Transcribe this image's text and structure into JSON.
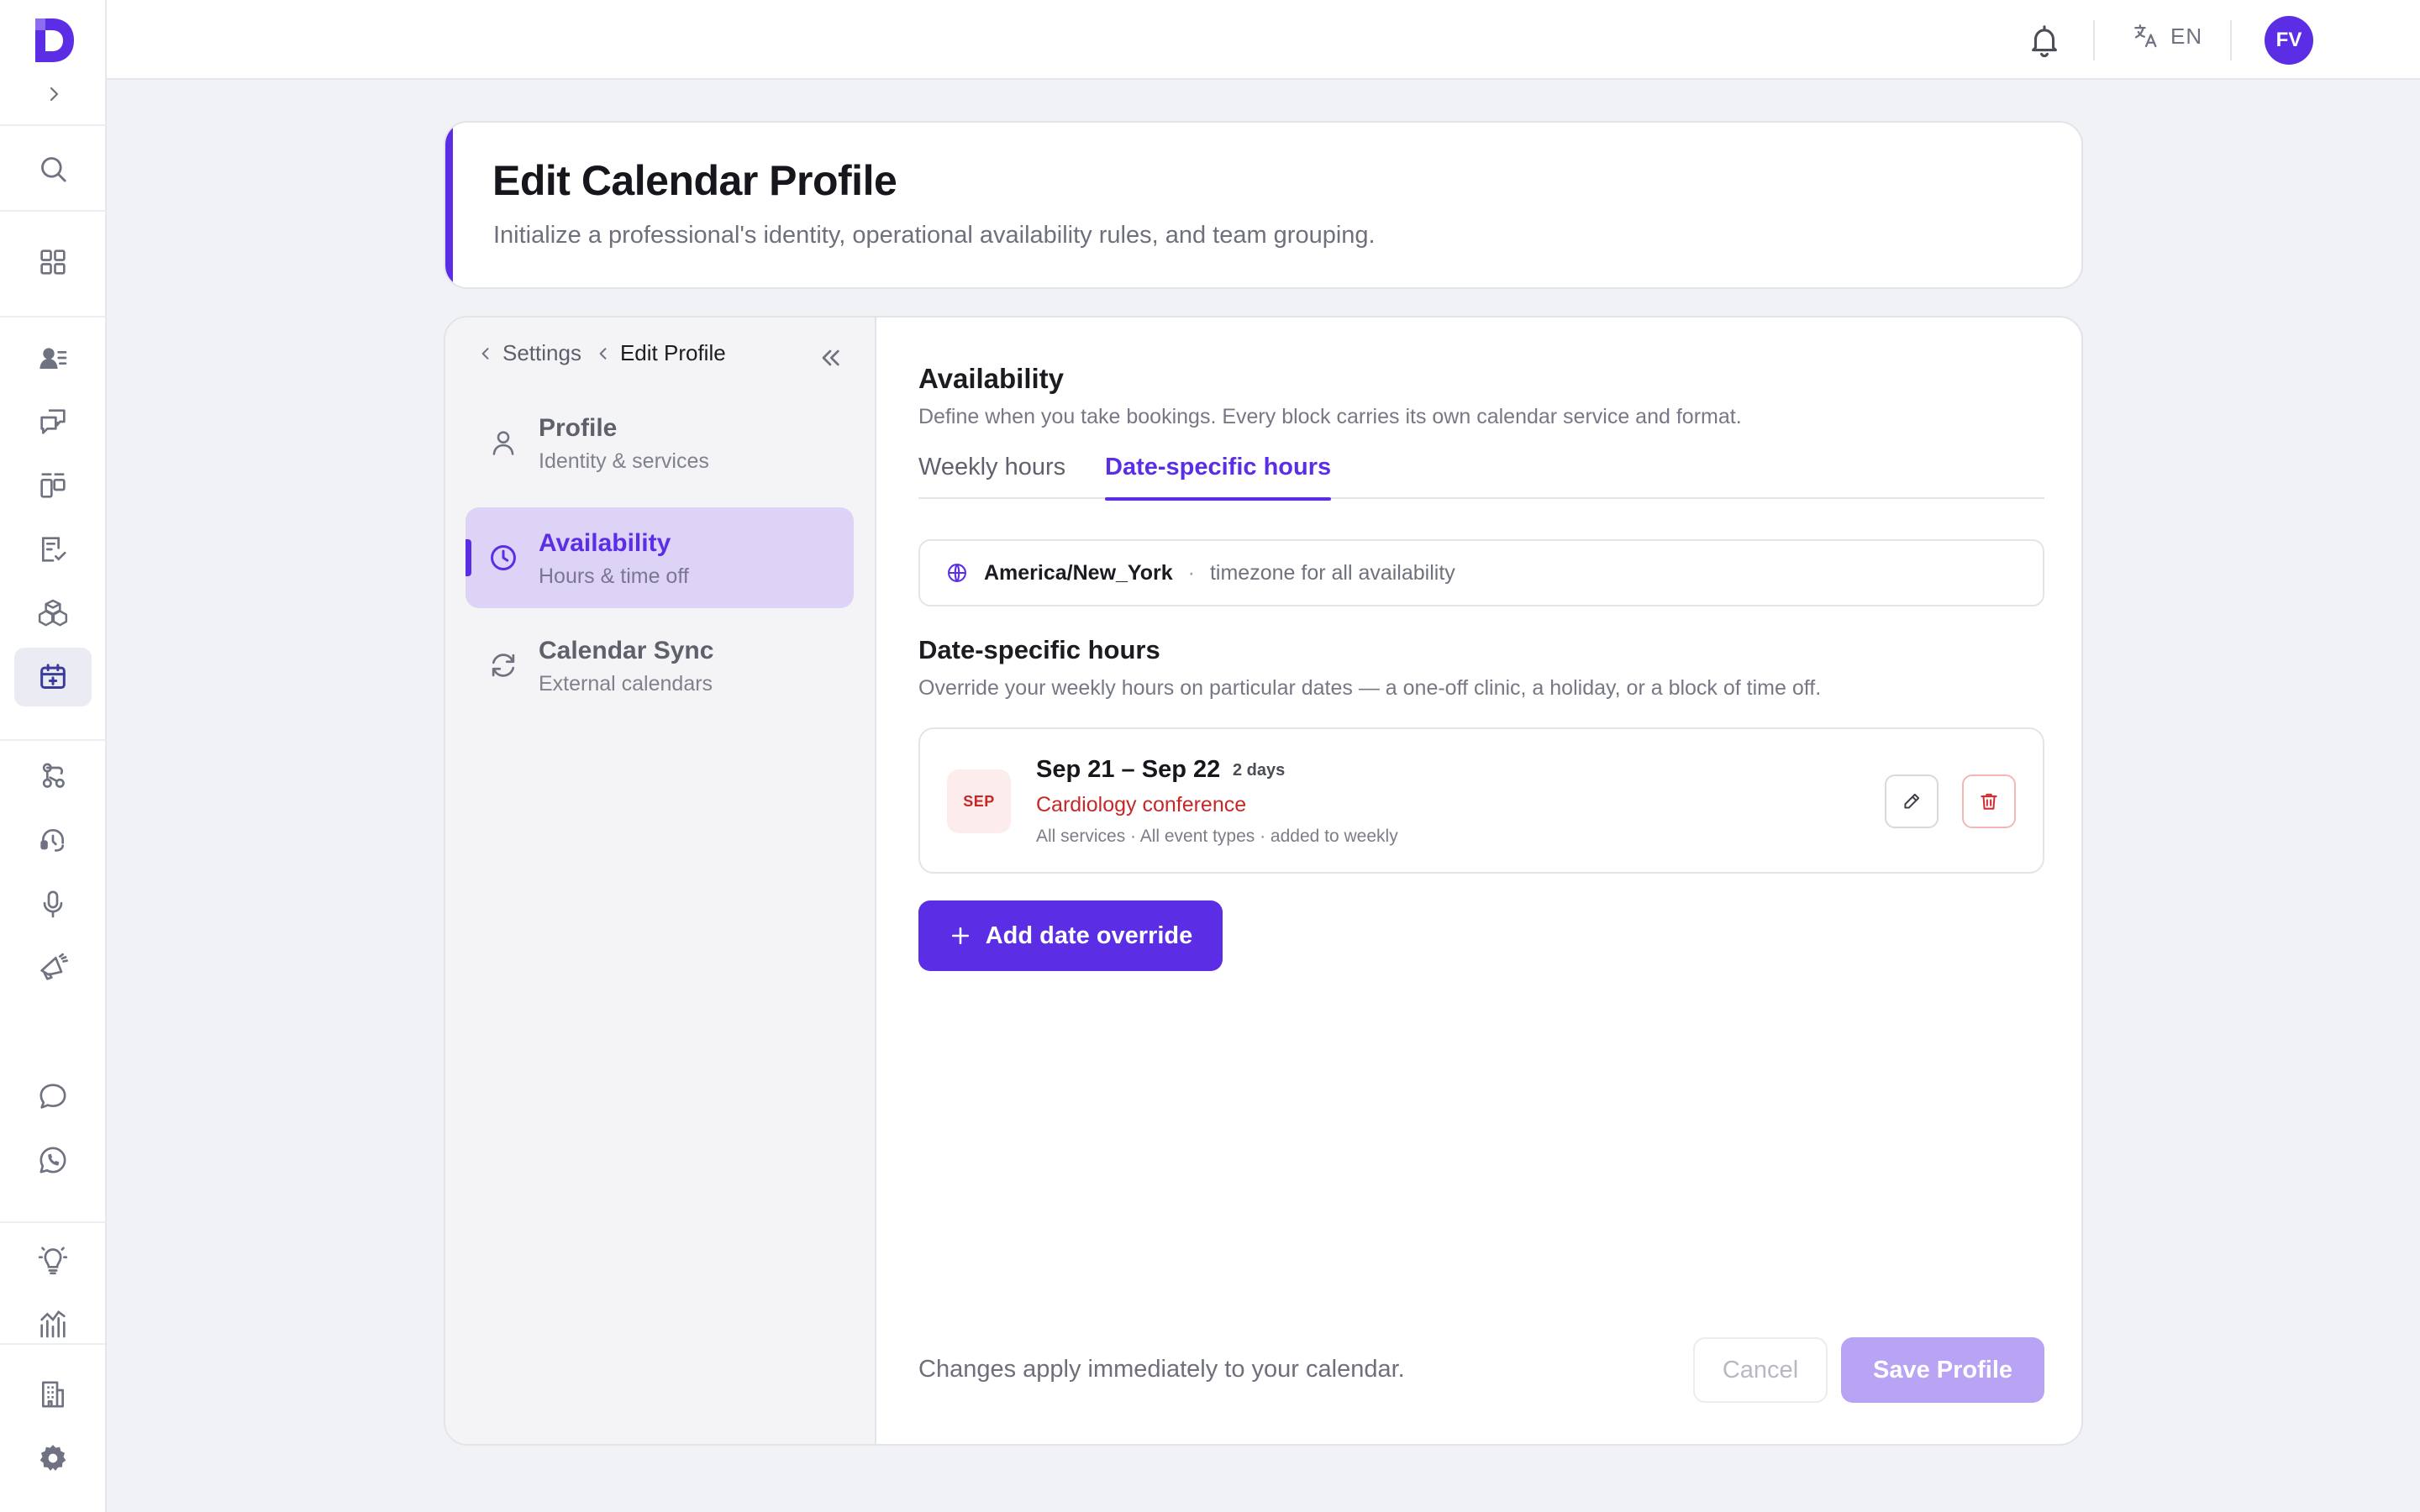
{
  "colors": {
    "accent": "#5b2ee6",
    "danger": "#c62828",
    "active_nav_bg": "#dcd3f6",
    "save_disabled": "#b8a3f5"
  },
  "rail": {
    "items": [
      {
        "name": "search-icon"
      },
      {
        "name": "dashboard-grid-icon"
      },
      {
        "name": "contacts-icon"
      },
      {
        "name": "conversations-icon"
      },
      {
        "name": "pipeline-icon"
      },
      {
        "name": "tasks-icon"
      },
      {
        "name": "products-icon"
      },
      {
        "name": "calendar-icon",
        "active": true
      },
      {
        "name": "workflows-icon"
      },
      {
        "name": "support-icon"
      },
      {
        "name": "voice-icon"
      },
      {
        "name": "campaigns-icon"
      },
      {
        "name": "chat-icon"
      },
      {
        "name": "whatsapp-icon"
      },
      {
        "name": "ideas-icon"
      },
      {
        "name": "analytics-icon"
      },
      {
        "name": "organization-icon"
      },
      {
        "name": "settings-icon"
      }
    ]
  },
  "topbar": {
    "language": "EN",
    "avatar_initials": "FV"
  },
  "header": {
    "title": "Edit Calendar Profile",
    "subtitle": "Initialize a professional's identity, operational availability rules, and team grouping."
  },
  "breadcrumb": {
    "parent": "Settings",
    "current": "Edit Profile"
  },
  "nav": [
    {
      "label": "Profile",
      "sub": "Identity & services"
    },
    {
      "label": "Availability",
      "sub": "Hours & time off",
      "active": true
    },
    {
      "label": "Calendar Sync",
      "sub": "External calendars"
    }
  ],
  "availability": {
    "title": "Availability",
    "subtitle": "Define when you take bookings. Every block carries its own calendar service and format.",
    "tabs": [
      {
        "label": "Weekly hours"
      },
      {
        "label": "Date-specific hours",
        "active": true
      }
    ],
    "timezone": {
      "name": "America/New_York",
      "separator": "·",
      "description": "timezone for all availability"
    },
    "date_specific": {
      "title": "Date-specific hours",
      "description": "Override your weekly hours on particular dates — a one-off clinic, a holiday, or a block of time off.",
      "overrides": [
        {
          "month": "SEP",
          "range": "Sep 21 – Sep 22",
          "duration": "2 days",
          "name": "Cardiology conference",
          "meta": "All services · All event types · added to weekly"
        }
      ],
      "add_label": "Add date override"
    }
  },
  "footer": {
    "note": "Changes apply immediately to your calendar.",
    "cancel_label": "Cancel",
    "save_label": "Save Profile"
  }
}
